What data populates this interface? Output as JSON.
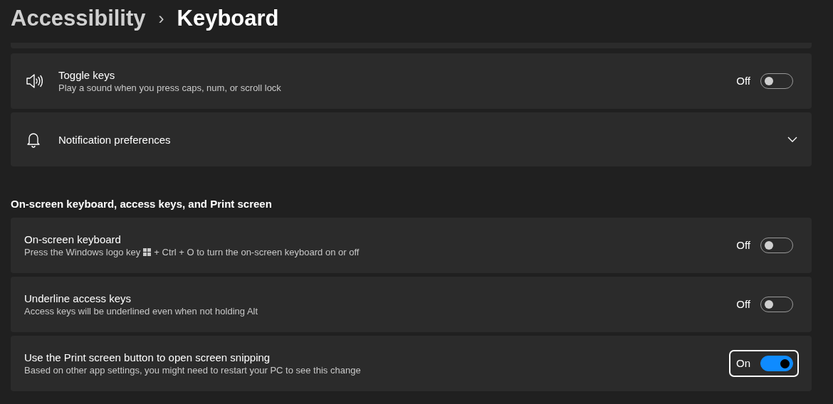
{
  "breadcrumb": {
    "parent": "Accessibility",
    "separator": "›",
    "current": "Keyboard"
  },
  "groups": [
    {
      "rows": [
        {
          "kind": "toggle",
          "title": "Toggle keys",
          "description": "Play a sound when you press caps, num, or scroll lock",
          "state_text": "Off",
          "on": false,
          "focused": false
        },
        {
          "kind": "expander",
          "title": "Notification preferences",
          "expanded": false
        }
      ]
    },
    {
      "heading": "On-screen keyboard, access keys, and Print screen",
      "rows": [
        {
          "kind": "toggle",
          "title": "On-screen keyboard",
          "description": "Press the Windows logo key",
          "description_after": "+ Ctrl + O to turn the on-screen keyboard on or off",
          "state_text": "Off",
          "on": false,
          "focused": false
        },
        {
          "kind": "toggle",
          "title": "Underline access keys",
          "description": "Access keys will be underlined even when not holding Alt",
          "state_text": "Off",
          "on": false,
          "focused": false
        },
        {
          "kind": "toggle",
          "title": "Use the Print screen button to open screen snipping",
          "description": "Based on other app settings, you might need to restart your PC to see this change",
          "state_text": "On",
          "on": true,
          "focused": true
        }
      ]
    }
  ]
}
